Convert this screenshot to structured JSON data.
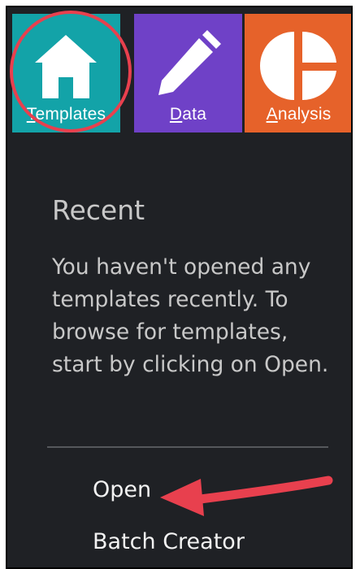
{
  "tiles": {
    "templates": {
      "label_access": "T",
      "label_rest": "emplates",
      "icon": "home-icon"
    },
    "data": {
      "label_access": "D",
      "label_rest": "ata",
      "icon": "pencil-icon"
    },
    "analysis": {
      "label_access": "A",
      "label_rest": "nalysis",
      "icon": "pie-chart-icon"
    }
  },
  "recent": {
    "heading": "Recent",
    "message": "You haven't opened any templates recently. To browse for templates, start by clicking on Open."
  },
  "menu": {
    "open_label": "Open",
    "batch_creator_label": "Batch Creator"
  },
  "colors": {
    "templates_tile": "#13a3a8",
    "data_tile": "#6f41c7",
    "analysis_tile": "#e6622a",
    "background": "#1f2125",
    "annotation": "#e8404e"
  }
}
